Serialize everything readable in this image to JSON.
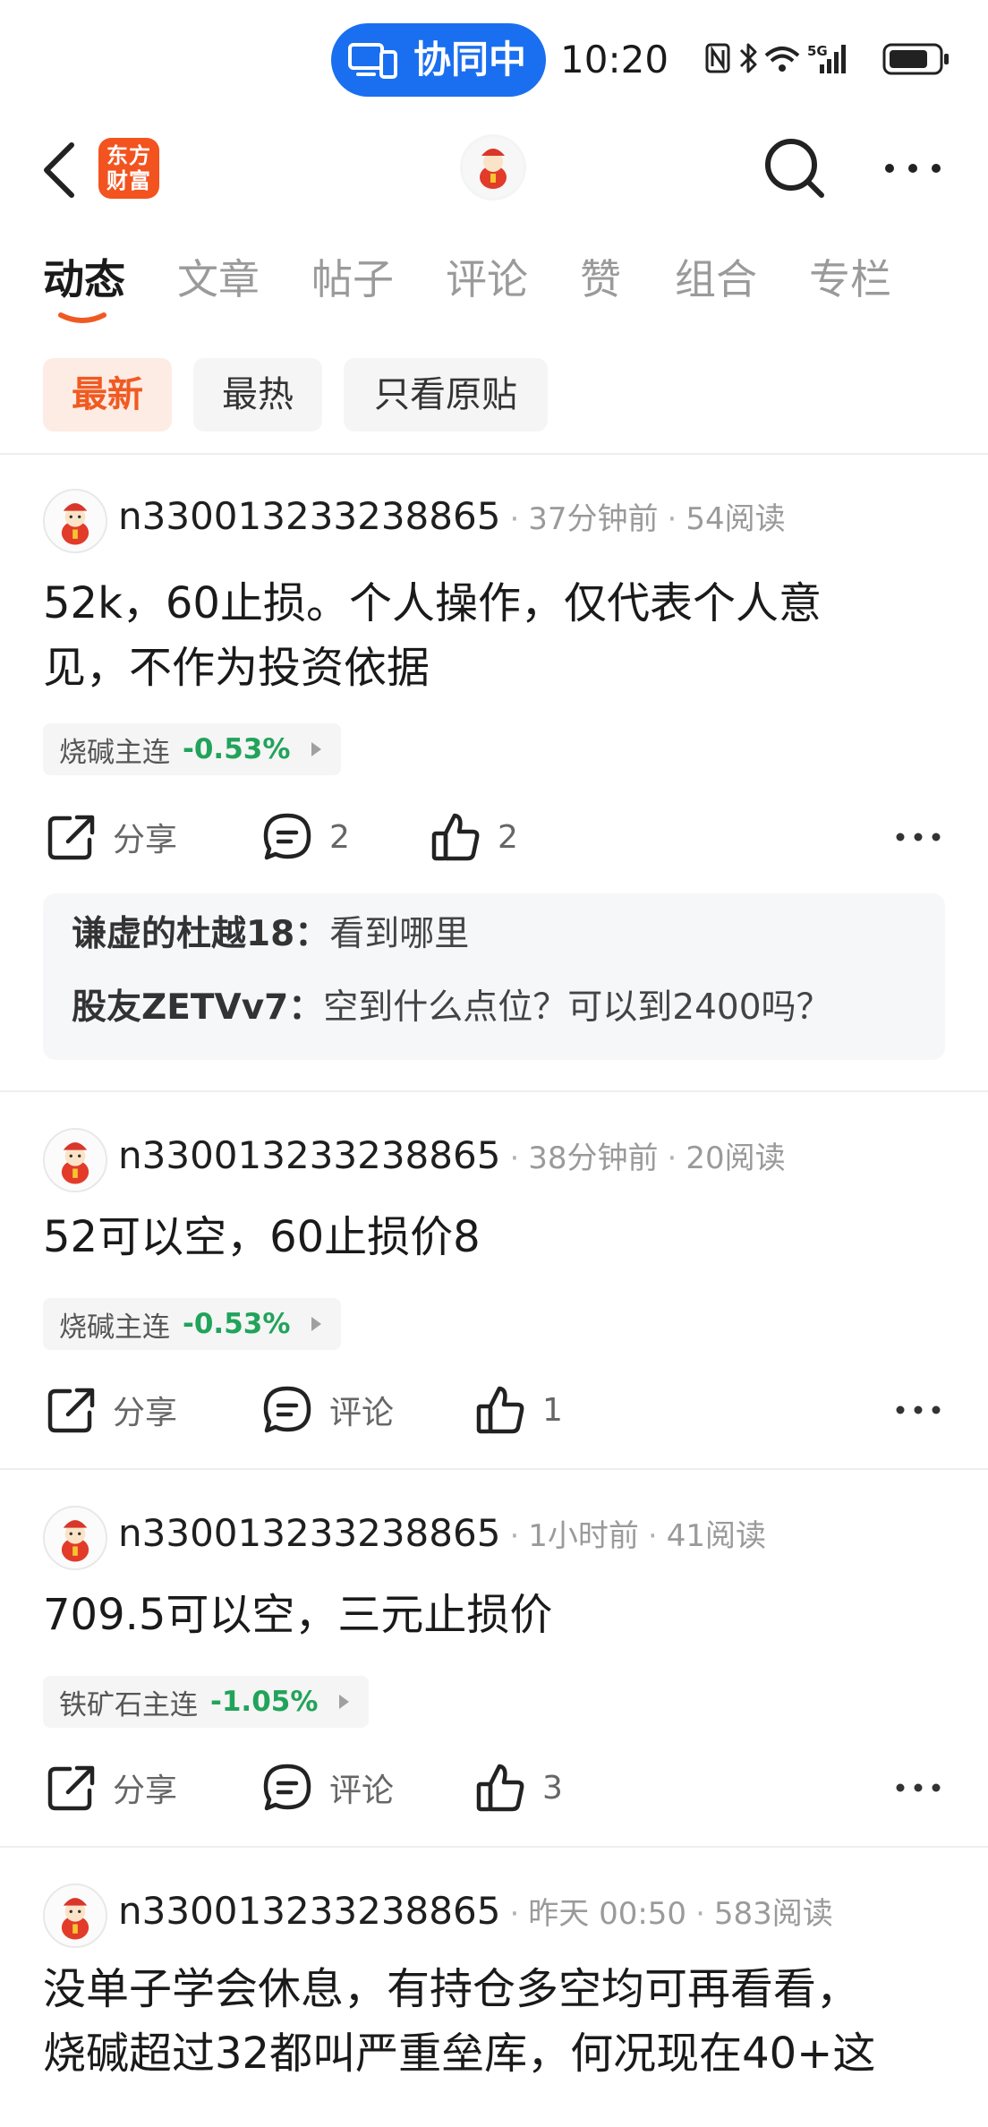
{
  "status_bar": {
    "collab_label": "协同中",
    "time": "10:20",
    "icons": [
      "nfc-icon",
      "bluetooth-icon",
      "wifi-icon",
      "5g-signal-icon",
      "battery-icon"
    ]
  },
  "nav": {
    "logo_text_line1": "东方",
    "logo_text_line2": "财富",
    "icons": [
      "back-icon",
      "avatar-icon",
      "search-icon",
      "more-icon"
    ]
  },
  "tabs": [
    {
      "label": "动态",
      "active": true
    },
    {
      "label": "文章",
      "active": false
    },
    {
      "label": "帖子",
      "active": false
    },
    {
      "label": "评论",
      "active": false
    },
    {
      "label": "赞",
      "active": false
    },
    {
      "label": "组合",
      "active": false
    },
    {
      "label": "专栏",
      "active": false
    }
  ],
  "filters": [
    {
      "label": "最新",
      "active": true
    },
    {
      "label": "最热",
      "active": false
    },
    {
      "label": "只看原贴",
      "active": false
    }
  ],
  "colors": {
    "accent": "#f05a22",
    "collab_blue": "#1a6ff0",
    "stock_down": "#21a35a"
  },
  "posts": [
    {
      "user": "n330013233238865",
      "time": "37分钟前",
      "reads": "54阅读",
      "body_line1": "52k，60止损。个人操作，仅代表个人意",
      "body_line2": "见，不作为投资依据",
      "stock_name": "烧碱主连",
      "stock_change": "-0.53%",
      "share_label": "分享",
      "comment_label": "2",
      "like_label": "2",
      "replies": [
        {
          "who": "谦虚的杜越18：",
          "text": "看到哪里"
        },
        {
          "who": "股友ZETVv7：",
          "text": "空到什么点位？可以到2400吗？"
        }
      ]
    },
    {
      "user": "n330013233238865",
      "time": "38分钟前",
      "reads": "20阅读",
      "body_line1": "52可以空，60止损价8",
      "stock_name": "烧碱主连",
      "stock_change": "-0.53%",
      "share_label": "分享",
      "comment_label": "评论",
      "like_label": "1"
    },
    {
      "user": "n330013233238865",
      "time": "1小时前",
      "reads": "41阅读",
      "body_line1": "709.5可以空，三元止损价",
      "stock_name": "铁矿石主连",
      "stock_change": "-1.05%",
      "share_label": "分享",
      "comment_label": "评论",
      "like_label": "3"
    },
    {
      "user": "n330013233238865",
      "time": "昨天 00:50",
      "reads": "583阅读",
      "body_line1": "没单子学会休息，有持仓多空均可再看看，",
      "body_line2": "烧碱超过32都叫严重垒库，何况现在40+这"
    }
  ]
}
